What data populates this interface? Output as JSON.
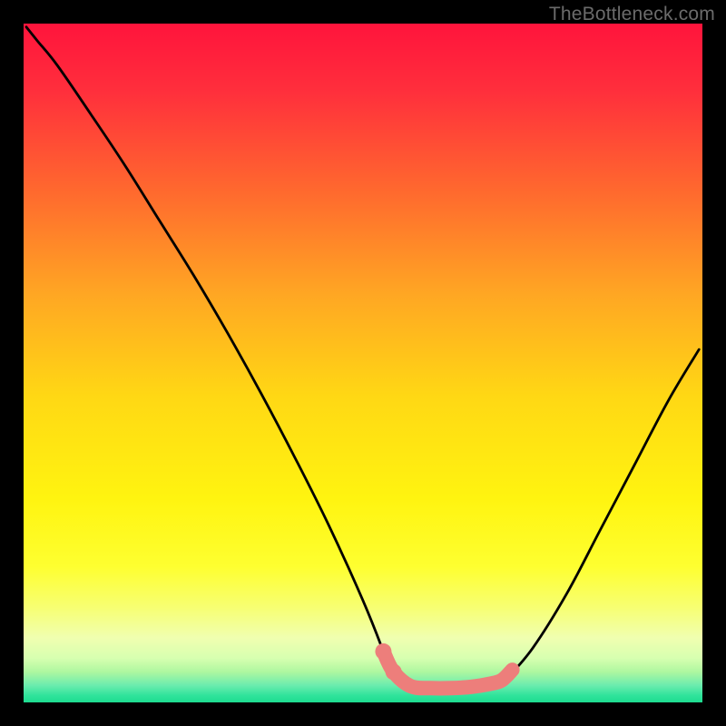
{
  "watermark": "TheBottleneck.com",
  "chart_data": {
    "type": "line",
    "title": "",
    "xlabel": "",
    "ylabel": "",
    "xlim": [
      0,
      100
    ],
    "ylim": [
      0,
      100
    ],
    "grid": false,
    "series": [
      {
        "name": "left-curve",
        "color": "#000000",
        "x": [
          0.4,
          2,
          5,
          10,
          15,
          20,
          25,
          30,
          35,
          40,
          45,
          50,
          53,
          54,
          55
        ],
        "y": [
          99.5,
          97.5,
          93.8,
          86.5,
          79,
          71,
          63,
          54.5,
          45.5,
          36,
          26,
          15,
          7.5,
          4.5,
          3
        ]
      },
      {
        "name": "valley-floor",
        "color": "#000000",
        "x": [
          55,
          57,
          60,
          63,
          66,
          69,
          71
        ],
        "y": [
          3,
          2.4,
          2.1,
          2.1,
          2.3,
          2.8,
          3.3
        ]
      },
      {
        "name": "right-curve",
        "color": "#000000",
        "x": [
          71,
          75,
          80,
          85,
          90,
          95,
          99.5
        ],
        "y": [
          3.3,
          8,
          16,
          25.5,
          35,
          44.5,
          52
        ]
      },
      {
        "name": "highlight-dots",
        "color": "#ED7E7B",
        "x": [
          53,
          54.5,
          57,
          60,
          63,
          66,
          69,
          70.5,
          72
        ],
        "y": [
          7.5,
          4.5,
          2.4,
          2.1,
          2.1,
          2.3,
          2.8,
          3.3,
          4.8
        ]
      }
    ],
    "background_gradient": {
      "stops": [
        {
          "offset": 0.0,
          "color": "#ff143c"
        },
        {
          "offset": 0.1,
          "color": "#ff2f3c"
        },
        {
          "offset": 0.25,
          "color": "#ff6a2e"
        },
        {
          "offset": 0.4,
          "color": "#ffa723"
        },
        {
          "offset": 0.55,
          "color": "#ffd814"
        },
        {
          "offset": 0.7,
          "color": "#fff410"
        },
        {
          "offset": 0.8,
          "color": "#feff30"
        },
        {
          "offset": 0.86,
          "color": "#f7ff72"
        },
        {
          "offset": 0.905,
          "color": "#f0ffb0"
        },
        {
          "offset": 0.935,
          "color": "#d7ffb0"
        },
        {
          "offset": 0.955,
          "color": "#aef7a0"
        },
        {
          "offset": 0.975,
          "color": "#6becae"
        },
        {
          "offset": 0.99,
          "color": "#2fe39b"
        },
        {
          "offset": 1.0,
          "color": "#1edc90"
        }
      ]
    }
  }
}
